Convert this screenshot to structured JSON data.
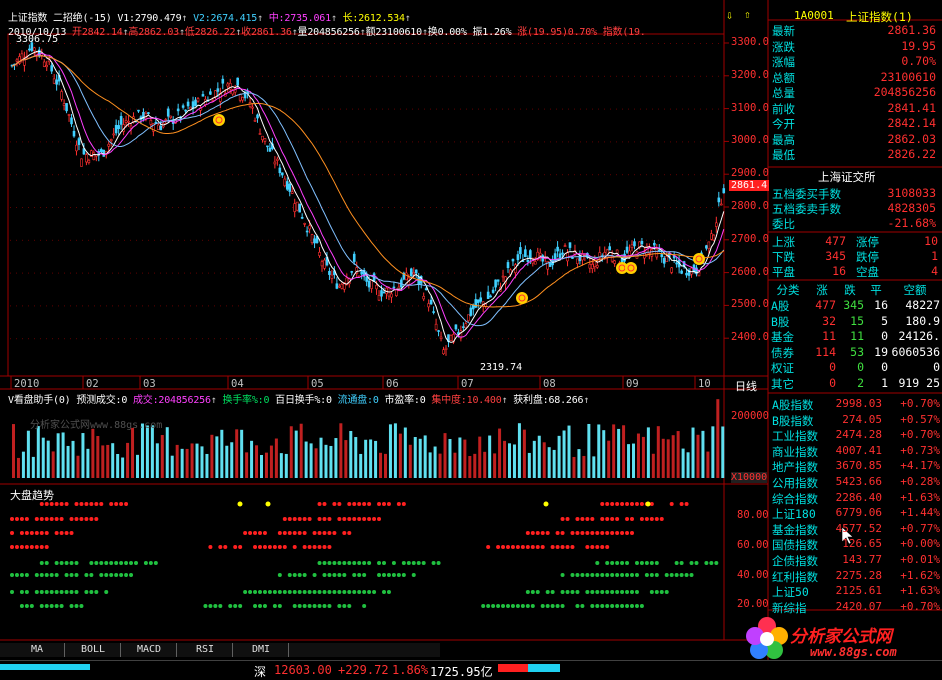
{
  "header": {
    "title": "上证指数",
    "period": "二招绝",
    "param": "(-15)",
    "v1": "V1:2790.479",
    "v2": "V2:2674.415",
    "mid": "中:2735.061",
    "long": "长:2612.534",
    "date": "2010/10/13",
    "open": "开2842.14",
    "high": "高2862.03",
    "low": "低2826.22",
    "close": "收2861.36",
    "vol": "量204856256",
    "amount": "额23100610",
    "turnover": "换0.00%",
    "amp": "振1.26%",
    "rise": "涨(19.95)0.70%",
    "index": "指数(19."
  },
  "price_axis": [
    "3300.0",
    "3200.0",
    "3100.0",
    "3000.0",
    "2900.0",
    "2800.0",
    "2700.0",
    "2600.0",
    "2500.0",
    "2400.0"
  ],
  "price_marker": "2861.4",
  "annot_high": "3306.75",
  "annot_low": "2319.74",
  "months": [
    "2010",
    "02",
    "03",
    "04",
    "05",
    "06",
    "07",
    "08",
    "09",
    "10"
  ],
  "day_line": "日线",
  "sub1": {
    "title": "V看盘助手(0)",
    "pred": "预测成交:0",
    "vol": "成交:204856256",
    "turn": "换手率%:0",
    "hundred": "百日换手%:0",
    "float": "流通盘:0",
    "pe": "市盈率:0",
    "conc": "集中度:10.400",
    "profit": "获利盘:68.266",
    "axis_top": "200000",
    "axis_unit": "X10000",
    "watermark": "分析家公式网www.88gs.com"
  },
  "sub2": {
    "title": "大盘趋势",
    "axis": [
      "80.00",
      "60.00",
      "40.00",
      "20.00"
    ]
  },
  "panel": {
    "code": "1A0001",
    "name": "上证指数(1)",
    "quote": [
      {
        "label": "最新",
        "value": "2861.36"
      },
      {
        "label": "涨跌",
        "value": "19.95"
      },
      {
        "label": "涨幅",
        "value": "0.70%"
      },
      {
        "label": "总额",
        "value": "23100610"
      },
      {
        "label": "总量",
        "value": "204856256"
      },
      {
        "label": "前收",
        "value": "2841.41"
      },
      {
        "label": "今开",
        "value": "2842.14"
      },
      {
        "label": "最高",
        "value": "2862.03"
      },
      {
        "label": "最低",
        "value": "2826.22"
      }
    ],
    "exchange": "上海证交所",
    "orders": [
      {
        "label": "五档委买手数",
        "value": "3108033"
      },
      {
        "label": "五档委卖手数",
        "value": "4828305"
      },
      {
        "label": "委比",
        "value": "-21.68%"
      }
    ],
    "breadth": [
      {
        "a": "上涨",
        "av": "477",
        "b": "涨停",
        "bv": "10"
      },
      {
        "a": "下跌",
        "av": "345",
        "b": "跌停",
        "bv": "1"
      },
      {
        "a": "平盘",
        "av": "16",
        "b": "空盘",
        "bv": "4"
      }
    ],
    "table_head": [
      "分类",
      "涨",
      "跌",
      "平",
      "空额"
    ],
    "table": [
      [
        "A股",
        "477",
        "345",
        "16",
        "48227"
      ],
      [
        "B股",
        "32",
        "15",
        "5",
        "180.9"
      ],
      [
        "基金",
        "11",
        "11",
        "0",
        "24126."
      ],
      [
        "债券",
        "114",
        "53",
        "19",
        "6060536"
      ],
      [
        "权证",
        "0",
        "0",
        "0",
        "0"
      ],
      [
        "其它",
        "0",
        "2",
        "1",
        "919 25"
      ]
    ],
    "indices": [
      {
        "n": "A股指数",
        "v": "2998.03",
        "p": "+0.70%"
      },
      {
        "n": "B股指数",
        "v": "274.05",
        "p": "+0.57%"
      },
      {
        "n": "工业指数",
        "v": "2474.28",
        "p": "+0.70%"
      },
      {
        "n": "商业指数",
        "v": "4007.41",
        "p": "+0.73%"
      },
      {
        "n": "地产指数",
        "v": "3670.85",
        "p": "+4.17%"
      },
      {
        "n": "公用指数",
        "v": "5423.66",
        "p": "+0.28%"
      },
      {
        "n": "综合指数",
        "v": "2286.40",
        "p": "+1.63%"
      },
      {
        "n": "上证180",
        "v": "6779.06",
        "p": "+1.44%"
      },
      {
        "n": "基金指数",
        "v": "4577.52",
        "p": "+0.77%"
      },
      {
        "n": "国债指数",
        "v": "126.65",
        "p": "+0.00%"
      },
      {
        "n": "企债指数",
        "v": "143.77",
        "p": "+0.01%"
      },
      {
        "n": "红利指数",
        "v": "2275.28",
        "p": "+1.62%"
      },
      {
        "n": "上证50",
        "v": "2125.61",
        "p": "+1.63%"
      },
      {
        "n": "新综指",
        "v": "2420.07",
        "p": "+0.70%"
      }
    ]
  },
  "tabs": [
    "MA",
    "BOLL",
    "MACD",
    "RSI",
    "DMI"
  ],
  "status": {
    "market": "深",
    "value": "12603.00",
    "change": "+229.72",
    "pct": "1.86%",
    "amount": "1725.95亿"
  },
  "logo": {
    "text": "分析家公式网",
    "url": "www.88gs.com"
  },
  "colors": {
    "up": "#ff3030",
    "down": "#40d0ff",
    "ma1": "#ffffff",
    "ma2": "#ff40ff",
    "ma3": "#80c0ff",
    "ma4": "#ff9020",
    "grid": "#800000"
  }
}
